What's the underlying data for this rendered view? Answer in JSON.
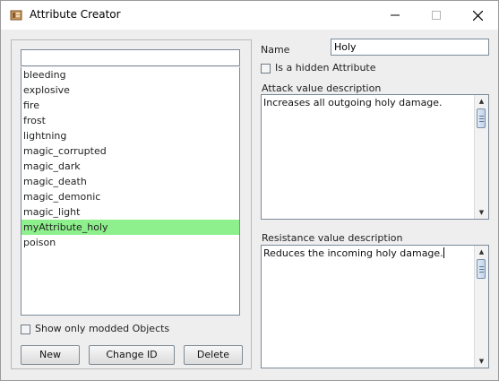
{
  "window": {
    "title": "Attribute Creator",
    "controls": {
      "minimize": "—",
      "maximize": "☐",
      "close": "✕"
    }
  },
  "sidebar": {
    "filter_value": "",
    "items": [
      {
        "label": "bleeding",
        "selected": false
      },
      {
        "label": "explosive",
        "selected": false
      },
      {
        "label": "fire",
        "selected": false
      },
      {
        "label": "frost",
        "selected": false
      },
      {
        "label": "lightning",
        "selected": false
      },
      {
        "label": "magic_corrupted",
        "selected": false
      },
      {
        "label": "magic_dark",
        "selected": false
      },
      {
        "label": "magic_death",
        "selected": false
      },
      {
        "label": "magic_demonic",
        "selected": false
      },
      {
        "label": "magic_light",
        "selected": false
      },
      {
        "label": "myAttribute_holy",
        "selected": true
      },
      {
        "label": "poison",
        "selected": false
      }
    ],
    "show_modded_label": "Show only modded Objects",
    "show_modded_checked": false,
    "buttons": {
      "new": "New",
      "change_id": "Change ID",
      "delete": "Delete"
    }
  },
  "form": {
    "name_label": "Name",
    "name_value": "Holy",
    "hidden_label": "Is a hidden Attribute",
    "hidden_checked": false,
    "attack_label": "Attack value description",
    "attack_value": "Increases all outgoing holy damage.",
    "resistance_label": "Resistance value description",
    "resistance_value": "Reduces the incoming holy damage."
  },
  "colors": {
    "selection": "#8ef08c",
    "window_bg": "#eeeeee"
  },
  "icons": {
    "app": "app-icon",
    "scroll_up": "arrow-up-icon",
    "scroll_down": "arrow-down-icon"
  }
}
